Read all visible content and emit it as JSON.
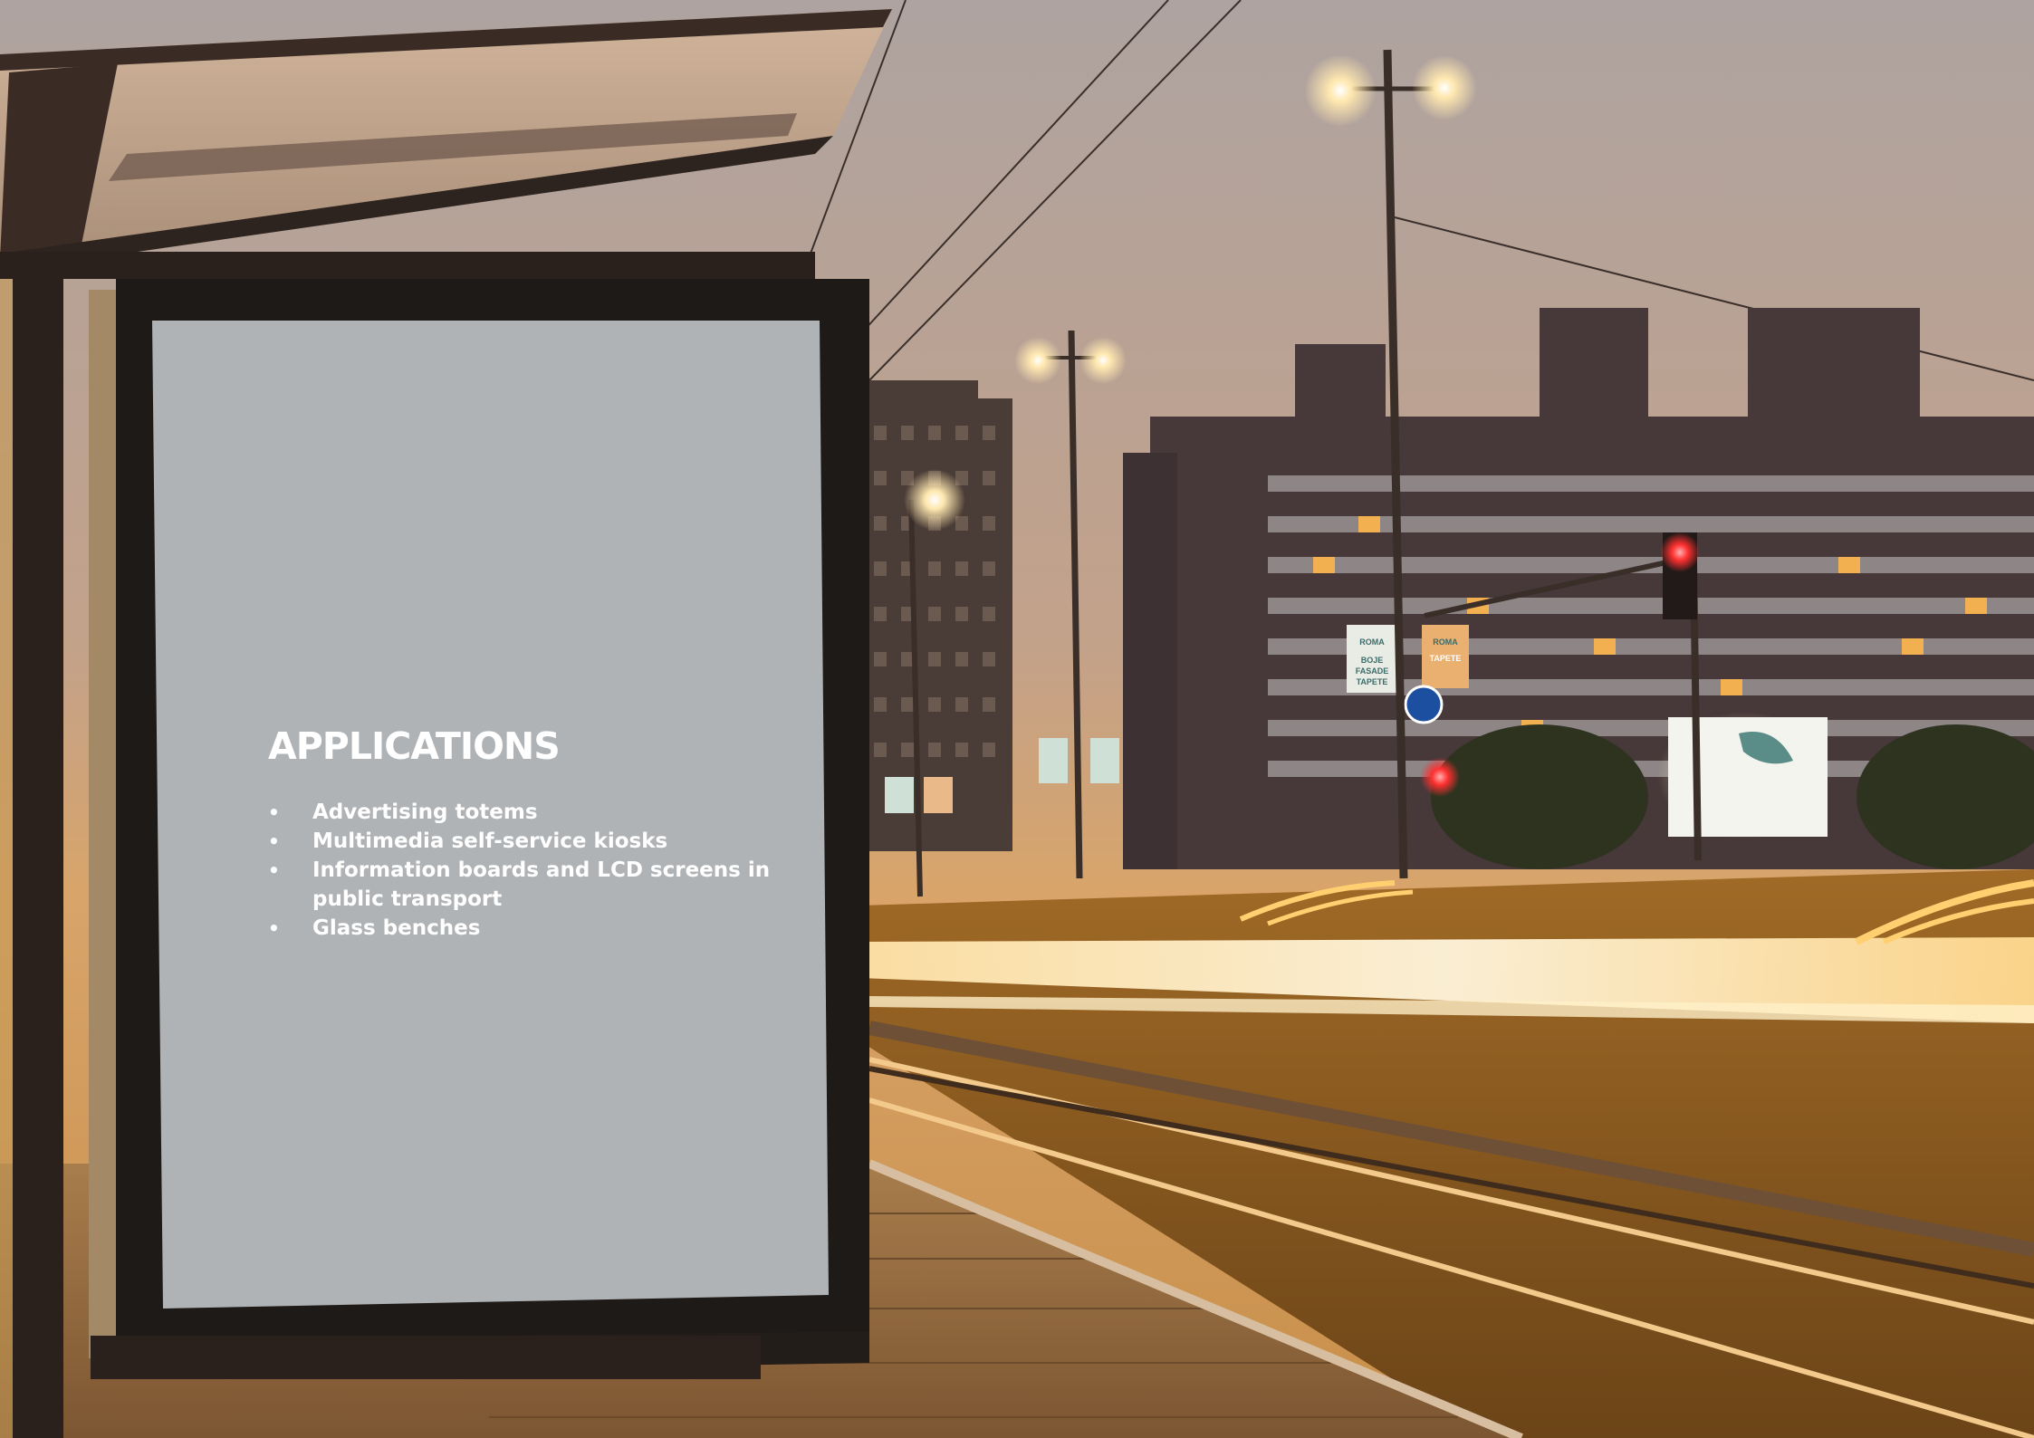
{
  "poster": {
    "title": "APPLICATIONS",
    "items": [
      "Advertising totems",
      "Multimedia self-service kiosks",
      "Information boards and LCD screens in public transport",
      "Glass benches"
    ]
  },
  "signs": {
    "left_panel_brand": "ROMA",
    "left_panel_text": "BOJE FASADE TAPETE",
    "right_panel_brand": "ROMA",
    "right_panel_text": "TAPETE"
  },
  "colors": {
    "sky_top": "#b7a597",
    "sky_horizon": "#d9a066",
    "poster_gray": "#b0b3b5",
    "frame_dark": "#1e1a17"
  }
}
